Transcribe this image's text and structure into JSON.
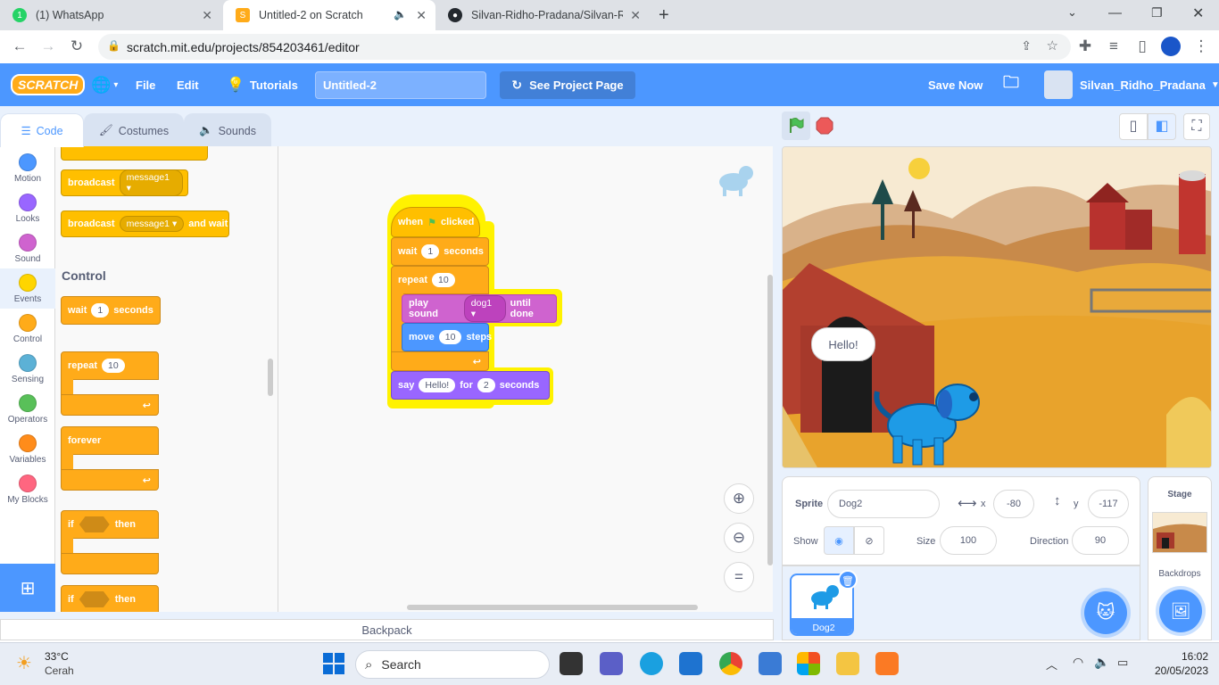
{
  "browser": {
    "tabs": [
      {
        "title": "(1) WhatsApp",
        "icon": "whatsapp-icon"
      },
      {
        "title": "Untitled-2 on Scratch",
        "icon": "scratch-icon",
        "active": true
      },
      {
        "title": "Silvan-Ridho-Pradana/Silvan-Ridh",
        "icon": "github-icon"
      }
    ],
    "url": "scratch.mit.edu/projects/854203461/editor"
  },
  "menubar": {
    "logo": "SCRATCH",
    "file": "File",
    "edit": "Edit",
    "tutorials": "Tutorials",
    "project_title": "Untitled-2",
    "see_project_page": "See Project Page",
    "save_now": "Save Now",
    "username": "Silvan_Ridho_Pradana"
  },
  "editor_tabs": {
    "code": "Code",
    "costumes": "Costumes",
    "sounds": "Sounds"
  },
  "categories": [
    {
      "label": "Motion",
      "color": "#4c97ff"
    },
    {
      "label": "Looks",
      "color": "#9966ff"
    },
    {
      "label": "Sound",
      "color": "#cf63cf"
    },
    {
      "label": "Events",
      "color": "#ffd500"
    },
    {
      "label": "Control",
      "color": "#ffab19"
    },
    {
      "label": "Sensing",
      "color": "#5cb1d6"
    },
    {
      "label": "Operators",
      "color": "#59c059"
    },
    {
      "label": "Variables",
      "color": "#ff8c1a"
    },
    {
      "label": "My Blocks",
      "color": "#ff6680"
    }
  ],
  "palette": {
    "broadcast": "broadcast",
    "message": "message1",
    "and_wait": "and wait",
    "control_heading": "Control",
    "wait": "wait",
    "wait_value": "1",
    "seconds": "seconds",
    "repeat": "repeat",
    "repeat_value": "10",
    "forever": "forever",
    "if": "if",
    "then": "then"
  },
  "script": {
    "when": "when",
    "clicked": "clicked",
    "wait": "wait",
    "wait_value": "1",
    "seconds": "seconds",
    "repeat": "repeat",
    "repeat_value": "10",
    "play_sound": "play sound",
    "sound_name": "dog1",
    "until_done": "until done",
    "move": "move",
    "move_value": "10",
    "steps": "steps",
    "say": "say",
    "say_text": "Hello!",
    "for": "for",
    "say_secs": "2",
    "secs": "seconds"
  },
  "backpack": "Backpack",
  "stage": {
    "speech": "Hello!"
  },
  "sprite_info": {
    "sprite_label": "Sprite",
    "sprite_name": "Dog2",
    "x_label": "x",
    "x": "-80",
    "y_label": "y",
    "y": "-117",
    "show_label": "Show",
    "size_label": "Size",
    "size": "100",
    "direction_label": "Direction",
    "direction": "90"
  },
  "sprite_list": [
    {
      "name": "Dog2"
    }
  ],
  "stage_panel": {
    "title": "Stage",
    "backdrops": "Backdrops"
  },
  "taskbar": {
    "temp": "33°C",
    "weather": "Cerah",
    "search": "Search",
    "time": "16:02",
    "date": "20/05/2023"
  }
}
